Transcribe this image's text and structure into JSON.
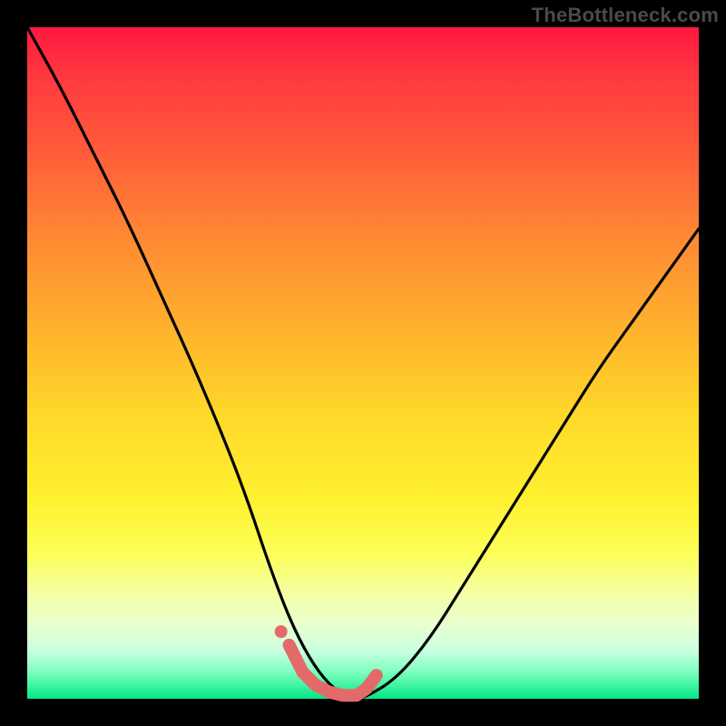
{
  "attribution": "TheBottleneck.com",
  "colors": {
    "page_bg": "#000000",
    "gradient_top": "#ff1840",
    "gradient_bottom": "#00e884",
    "curve": "#000000",
    "marker": "#e46a6a"
  },
  "chart_data": {
    "type": "line",
    "title": "",
    "xlabel": "",
    "ylabel": "",
    "xlim": [
      0,
      100
    ],
    "ylim": [
      0,
      100
    ],
    "grid": false,
    "legend": false,
    "series": [
      {
        "name": "bottleneck-curve",
        "x": [
          0,
          5,
          10,
          15,
          20,
          25,
          30,
          33,
          36,
          39,
          42,
          45,
          48,
          50,
          55,
          60,
          65,
          70,
          75,
          80,
          85,
          90,
          95,
          100
        ],
        "y": [
          100,
          91,
          81,
          71,
          60,
          49,
          37,
          29,
          20,
          12,
          6,
          2,
          0,
          0,
          3,
          9,
          17,
          25,
          33,
          41,
          49,
          56,
          63,
          70
        ]
      }
    ],
    "markers": {
      "name": "trough-markers",
      "x": [
        39,
        41,
        43,
        45,
        47,
        49,
        50.5,
        52
      ],
      "y": [
        8,
        4,
        2,
        1,
        0.5,
        0.5,
        1.5,
        3.5
      ]
    }
  }
}
